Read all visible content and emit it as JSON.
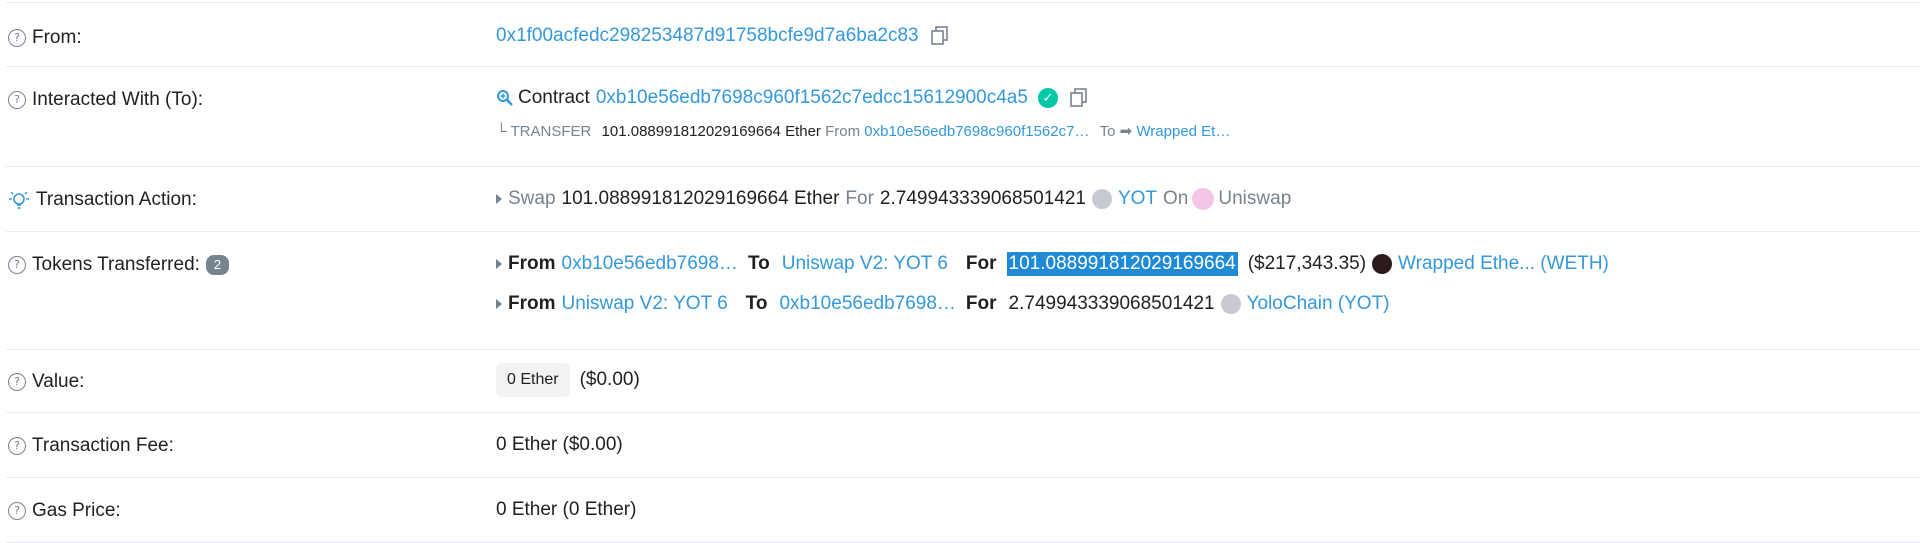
{
  "rows": {
    "from": {
      "label": "From:",
      "address": "0x1f00acfedc298253487d91758bcfe9d7a6ba2c83"
    },
    "interacted": {
      "label": "Interacted With (To):",
      "contract_word": "Contract",
      "address": "0xb10e56edb7698c960f1562c7edcc15612900c4a5",
      "transfer_prefix": "└ TRANSFER",
      "transfer_amount": "101.088991812029169664 Ether",
      "transfer_from_word": "From",
      "transfer_from_addr": "0xb10e56edb7698c960f1562c7…",
      "transfer_to_word": "To",
      "transfer_to_arrow": "➡",
      "transfer_to_name": "Wrapped Et…"
    },
    "action": {
      "label": "Transaction Action:",
      "swap_word": "Swap",
      "amount1": "101.088991812029169664 Ether",
      "for_word": "For",
      "amount2": "2.749943339068501421",
      "token": "YOT",
      "on_word": "On",
      "dex": "Uniswap"
    },
    "tokens": {
      "label": "Tokens Transferred:",
      "count": "2",
      "transfers": [
        {
          "from_word": "From",
          "from": "0xb10e56edb7698…",
          "to_word": "To",
          "to": "Uniswap V2: YOT 6",
          "for_word": "For",
          "amount": "101.088991812029169664",
          "usd": "($217,343.35)",
          "token": "Wrapped Ethe... (WETH)"
        },
        {
          "from_word": "From",
          "from": "Uniswap V2: YOT 6",
          "to_word": "To",
          "to": "0xb10e56edb7698…",
          "for_word": "For",
          "amount": "2.749943339068501421",
          "token": "YoloChain (YOT)"
        }
      ]
    },
    "value": {
      "label": "Value:",
      "pill": "0 Ether",
      "usd": "($0.00)"
    },
    "fee": {
      "label": "Transaction Fee:",
      "value": "0 Ether ($0.00)"
    },
    "gas": {
      "label": "Gas Price:",
      "value": "0 Ether (0 Ether)"
    }
  },
  "colors": {
    "link": "#3498db",
    "muted": "#77838f",
    "success": "#00c9a7",
    "highlight": "#1f8ad6",
    "border": "#e7eaf3"
  }
}
